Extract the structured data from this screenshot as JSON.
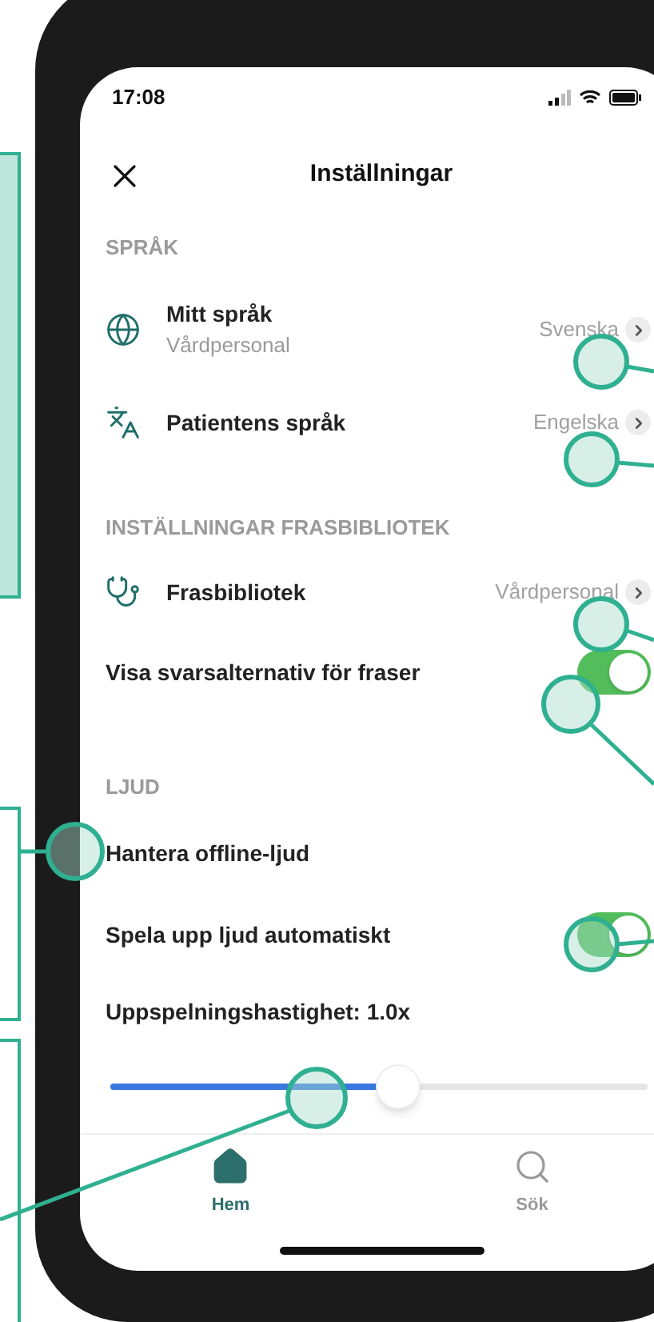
{
  "status_bar": {
    "time": "17:08"
  },
  "header": {
    "title": "Inställningar"
  },
  "sections": [
    {
      "title": "SPRÅK",
      "rows": [
        {
          "kind": "link",
          "label": "Mitt språk",
          "sublabel": "Vårdpersonal",
          "value": "Svenska"
        },
        {
          "kind": "link",
          "label": "Patientens språk",
          "value": "Engelska"
        }
      ]
    },
    {
      "title": "INSTÄLLNINGAR FRASBIBLIOTEK",
      "rows": [
        {
          "kind": "link",
          "label": "Frasbibliotek",
          "value": "Vårdpersonal"
        },
        {
          "kind": "toggle",
          "label": "Visa svarsalternativ för fraser",
          "on": true
        }
      ]
    },
    {
      "title": "LJUD",
      "rows": [
        {
          "kind": "plain",
          "label": "Hantera offline-ljud"
        },
        {
          "kind": "toggle",
          "label": "Spela upp ljud automatiskt",
          "on": true
        },
        {
          "kind": "slider",
          "label": "Uppspelningshastighet: 1.0x",
          "level": 0.5
        }
      ]
    }
  ],
  "tab_bar": [
    {
      "label": "Hem",
      "selected": true
    },
    {
      "label": "Sök",
      "selected": false
    }
  ]
}
